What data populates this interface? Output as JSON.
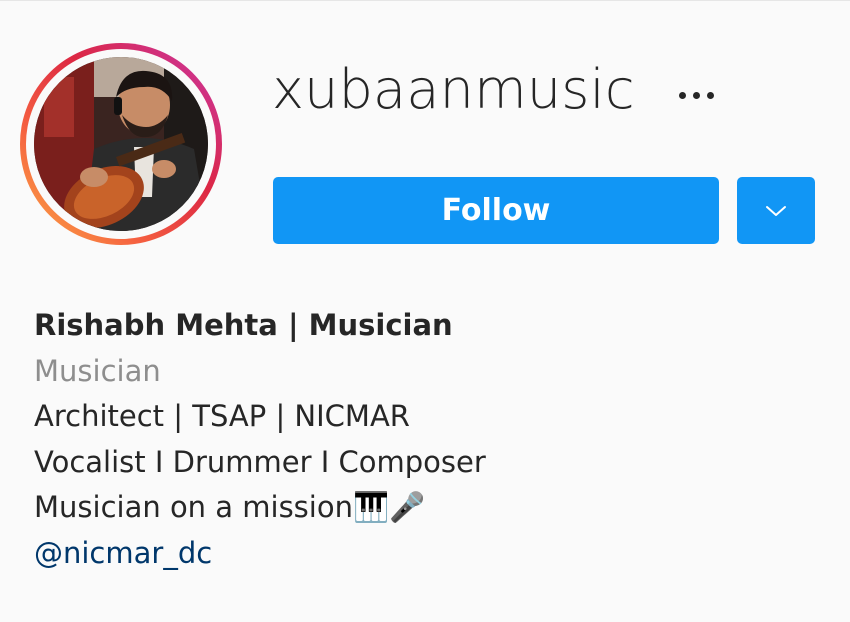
{
  "profile": {
    "username": "xubaanmusic",
    "avatar_alt": "profile-photo"
  },
  "actions": {
    "follow_label": "Follow",
    "more_icon": "more-horizontal-icon",
    "dropdown_icon": "chevron-down-icon"
  },
  "bio": {
    "full_name": "Rishabh Mehta | Musician",
    "category": "Musician",
    "lines": [
      "Architect | TSAP | NICMAR",
      "Vocalist I Drummer I Composer",
      "Musician on a mission🎹🎤"
    ],
    "link": "@nicmar_dc"
  },
  "colors": {
    "follow_blue": "#1196f5",
    "link_blue": "#00376b",
    "category_gray": "#8e8e8e",
    "text": "#262626",
    "background": "#fafafa"
  }
}
